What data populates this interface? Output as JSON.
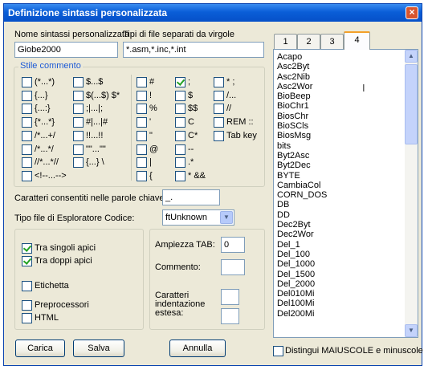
{
  "title": "Definizione sintassi personalizzata",
  "name_label": "Nome sintassi personalizzata",
  "name_value": "Giobe2000",
  "ext_label": "Tipi di file separati da virgole",
  "ext_value": "*.asm,*.inc,*.int",
  "comment_group_label": "Stile commento",
  "comment_col1": [
    "(*...*)",
    "{...}",
    "{...:}",
    "{*...*}",
    "/*...+/",
    "/*...*/",
    "//*...*//",
    "<!--...-->"
  ],
  "comment_col2": [
    "$...$",
    "$(...$) $*",
    ";|...|;",
    "#|...|#",
    "!!...!!",
    "\"\"...\"\"",
    "{...} \\"
  ],
  "comment_col3": [
    "#",
    "!",
    "%",
    "'",
    "\"",
    "@",
    "|",
    "{"
  ],
  "comment_col4": [
    ";",
    "$",
    "$$",
    "C",
    "C*",
    "--",
    ".*",
    "* &&"
  ],
  "comment_col5": [
    "* ;",
    "/...",
    "//",
    "REM ::",
    "Tab key"
  ],
  "chars_label": "Caratteri consentiti nelle parole chiave:",
  "chars_value": "_.",
  "explorer_label": "Tipo file di Esploratore Codice:",
  "explorer_value": "ftUnknown",
  "opt_single_quotes": "Tra singoli apici",
  "opt_double_quotes": "Tra doppi apici",
  "opt_label": "Etichetta",
  "opt_preproc": "Preprocessori",
  "opt_html": "HTML",
  "tab_width_label": "Ampiezza TAB:",
  "tab_width_value": "0",
  "comment_label": "Commento:",
  "indent_label_1": "Caratteri",
  "indent_label_2": "indentazione",
  "indent_label_3": "estesa:",
  "tabs": [
    "1",
    "2",
    "3",
    "4"
  ],
  "keywords": [
    "Acapo",
    "Asc2Byt",
    "Asc2Nib",
    "Asc2Wor",
    "BioBeep",
    "BioChr1",
    "BiosChr",
    "BioSCls",
    "BiosMsg",
    "bits",
    "Byt2Asc",
    "Byt2Dec",
    "BYTE",
    "CambiaCol",
    "CORN_DOS",
    "DB",
    "DD",
    "Dec2Byt",
    "Dec2Wor",
    "Del_1",
    "Del_100",
    "Del_1000",
    "Del_1500",
    "Del_2000",
    "Del010Mi",
    "Del100Mi",
    "Del200Mi"
  ],
  "case_label": "Distingui MAIUSCOLE e minuscole",
  "btn_load": "Carica",
  "btn_save": "Salva",
  "btn_cancel": "Annulla",
  "close_glyph": "×",
  "arrow_up": "▲",
  "arrow_down": "▼",
  "cursor_glyph": "I"
}
